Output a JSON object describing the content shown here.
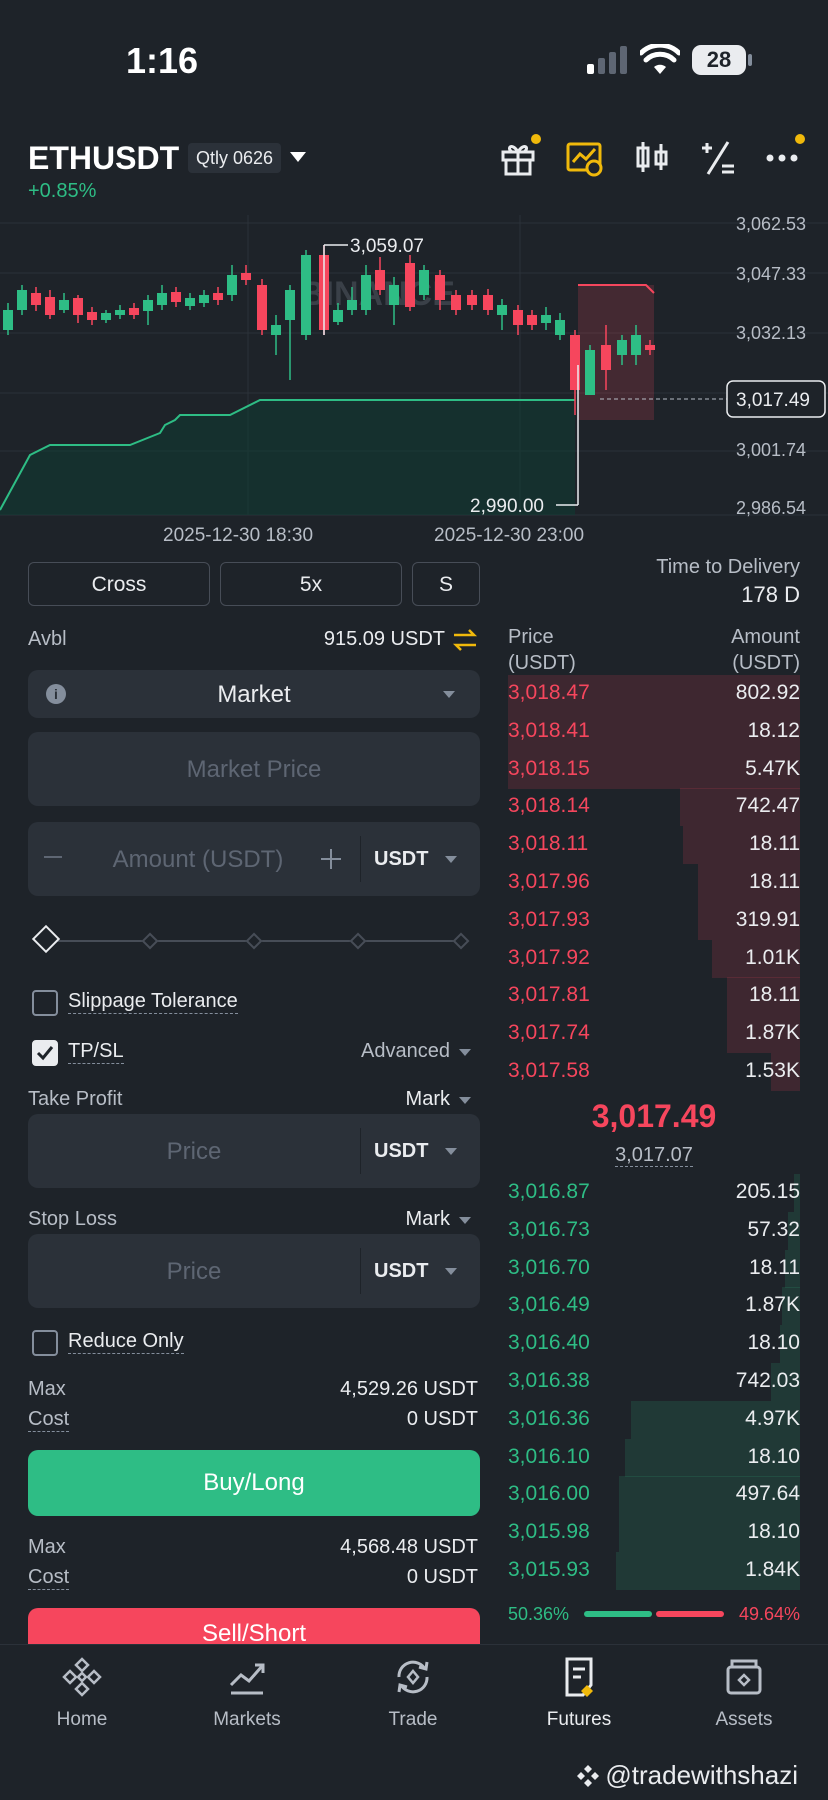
{
  "status": {
    "time": "1:16",
    "battery": "28"
  },
  "header": {
    "symbol": "ETHUSDT",
    "contract": "Qtly 0626",
    "change": "+0.85%"
  },
  "chart": {
    "y_labels": [
      "3,062.53",
      "3,047.33",
      "3,032.13",
      "3,001.74",
      "2,986.54"
    ],
    "current_price": "3,017.49",
    "high_label": "3,059.07",
    "low_label": "2,990.00",
    "x_labels": [
      "2025-12-30 18:30",
      "2025-12-30 23:00"
    ],
    "watermark": "BINANCE"
  },
  "controls": {
    "margin_mode": "Cross",
    "leverage": "5x",
    "position_mode": "S"
  },
  "delivery": {
    "label": "Time to Delivery",
    "value": "178 D"
  },
  "order": {
    "avbl_label": "Avbl",
    "avbl_value": "915.09 USDT",
    "order_type": "Market",
    "price_placeholder": "Market Price",
    "amount_placeholder": "Amount (USDT)",
    "amount_unit": "USDT",
    "slippage_label": "Slippage Tolerance",
    "tpsl_label": "TP/SL",
    "advanced_label": "Advanced",
    "tp_label": "Take Profit",
    "tp_trigger": "Mark",
    "tp_placeholder": "Price",
    "tp_unit": "USDT",
    "sl_label": "Stop Loss",
    "sl_trigger": "Mark",
    "sl_placeholder": "Price",
    "sl_unit": "USDT",
    "reduce_only_label": "Reduce Only",
    "buy": {
      "max_label": "Max",
      "max_value": "4,529.26 USDT",
      "cost_label": "Cost",
      "cost_value": "0 USDT",
      "button": "Buy/Long"
    },
    "sell": {
      "max_label": "Max",
      "max_value": "4,568.48 USDT",
      "cost_label": "Cost",
      "cost_value": "0 USDT",
      "button": "Sell/Short"
    }
  },
  "orderbook": {
    "price_header": "Price",
    "price_unit": "(USDT)",
    "amount_header": "Amount",
    "amount_unit": "(USDT)",
    "asks": [
      {
        "price": "3,018.47",
        "amount": "802.92",
        "depth": 1.0
      },
      {
        "price": "3,018.41",
        "amount": "18.12",
        "depth": 1.0
      },
      {
        "price": "3,018.15",
        "amount": "5.47K",
        "depth": 1.0
      },
      {
        "price": "3,018.14",
        "amount": "742.47",
        "depth": 0.41
      },
      {
        "price": "3,018.11",
        "amount": "18.11",
        "depth": 0.4
      },
      {
        "price": "3,017.96",
        "amount": "18.11",
        "depth": 0.35
      },
      {
        "price": "3,017.93",
        "amount": "319.91",
        "depth": 0.35
      },
      {
        "price": "3,017.92",
        "amount": "1.01K",
        "depth": 0.3
      },
      {
        "price": "3,017.81",
        "amount": "18.11",
        "depth": 0.25
      },
      {
        "price": "3,017.74",
        "amount": "1.87K",
        "depth": 0.25
      },
      {
        "price": "3,017.58",
        "amount": "1.53K",
        "depth": 0.1
      }
    ],
    "last_price": "3,017.49",
    "mark_price": "3,017.07",
    "bids": [
      {
        "price": "3,016.87",
        "amount": "205.15",
        "depth": 0.02
      },
      {
        "price": "3,016.73",
        "amount": "57.32",
        "depth": 0.04
      },
      {
        "price": "3,016.70",
        "amount": "18.11",
        "depth": 0.05
      },
      {
        "price": "3,016.49",
        "amount": "1.87K",
        "depth": 0.06
      },
      {
        "price": "3,016.40",
        "amount": "18.10",
        "depth": 0.07
      },
      {
        "price": "3,016.38",
        "amount": "742.03",
        "depth": 0.1
      },
      {
        "price": "3,016.36",
        "amount": "4.97K",
        "depth": 0.58
      },
      {
        "price": "3,016.10",
        "amount": "18.10",
        "depth": 0.6
      },
      {
        "price": "3,016.00",
        "amount": "497.64",
        "depth": 0.62
      },
      {
        "price": "3,015.98",
        "amount": "18.10",
        "depth": 0.62
      },
      {
        "price": "3,015.93",
        "amount": "1.84K",
        "depth": 0.63
      }
    ],
    "bid_ratio": "50.36%",
    "ask_ratio": "49.64%"
  },
  "nav": [
    {
      "label": "Home",
      "icon": "binance-logo-icon"
    },
    {
      "label": "Markets",
      "icon": "chart-trend-icon"
    },
    {
      "label": "Trade",
      "icon": "exchange-icon"
    },
    {
      "label": "Futures",
      "icon": "futures-doc-icon"
    },
    {
      "label": "Assets",
      "icon": "wallet-icon"
    }
  ],
  "watermark": "@tradewithshazi",
  "colors": {
    "bg": "#1e2329",
    "green": "#2ebd85",
    "red": "#f6465d",
    "yellow": "#f0b90b"
  }
}
